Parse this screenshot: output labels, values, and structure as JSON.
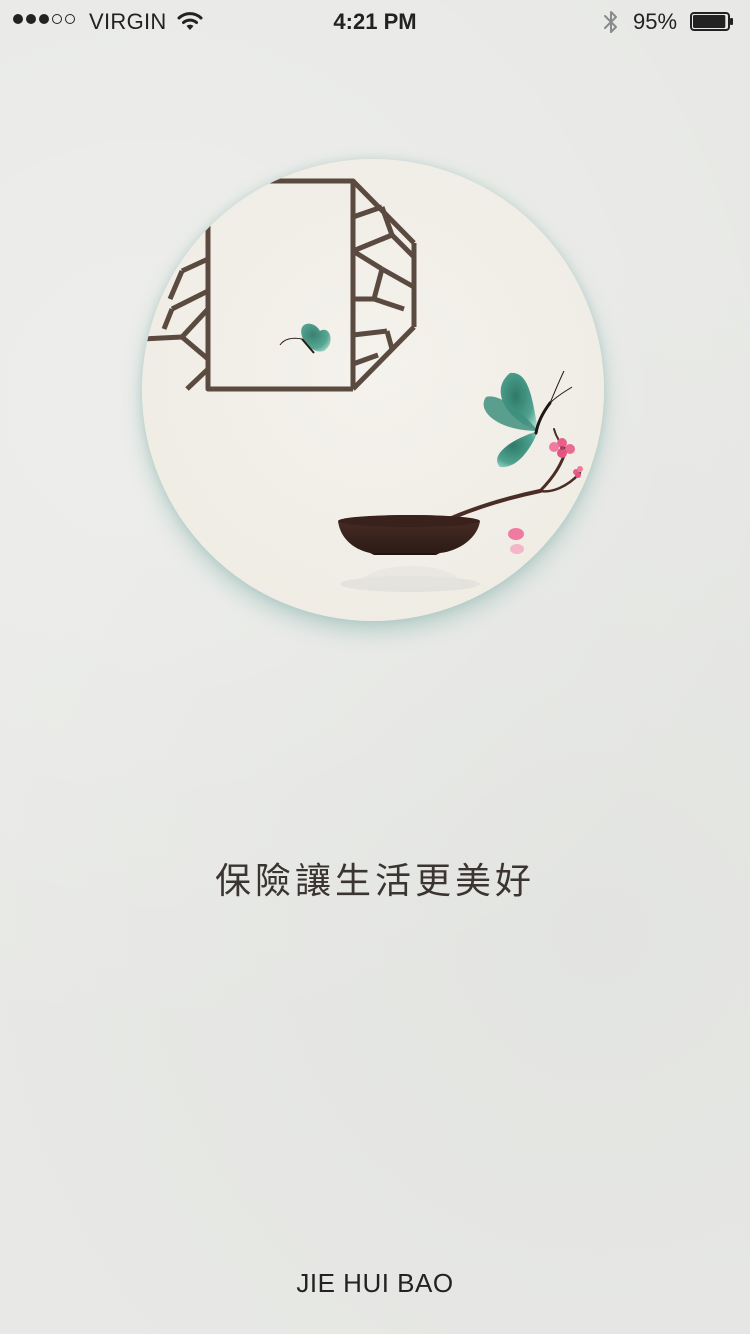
{
  "status_bar": {
    "carrier": "VIRGIN",
    "time": "4:21 PM",
    "battery_percent": "95%",
    "signal_bars_filled": 3,
    "signal_bars_total": 5,
    "battery_level": 0.95
  },
  "splash": {
    "slogan": "保險讓生活更美好",
    "brand": "JIE HUI BAO"
  },
  "colors": {
    "background": "#e8e9e6",
    "circle_fill": "#f2f0ea",
    "frame_brown": "#5a4a40",
    "butterfly_teal": "#3f8f7e",
    "blossom_pink": "#e8608a",
    "text_dark": "#3a3432"
  }
}
